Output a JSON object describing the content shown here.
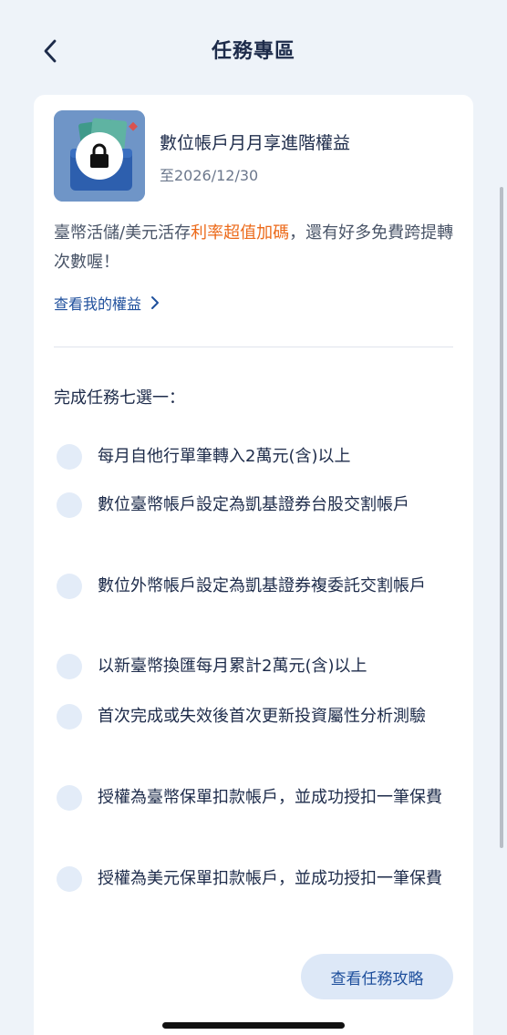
{
  "header": {
    "title": "任務專區",
    "back_icon": "chevron-left-icon"
  },
  "promo": {
    "image_icon": "lock-icon",
    "title": "數位帳戶月月享進階權益",
    "date": "至2026/12/30",
    "desc_before": "臺幣活儲/美元活存",
    "desc_highlight": "利率超值加碼",
    "desc_after": "，還有好多免費跨提轉次數喔！",
    "highlight_color": "#ec6a1a",
    "link_label": "查看我的權益",
    "link_icon": "chevron-right-icon"
  },
  "tasks": {
    "label": "完成任務七選一：",
    "items": [
      {
        "label": "每月自他行單筆轉入2萬元(含)以上"
      },
      {
        "label": "數位臺幣帳戶設定為凱基證券台股交割帳戶"
      },
      {
        "label": "數位外幣帳戶設定為凱基證券複委託交割帳戶"
      },
      {
        "label": "以新臺幣換匯每月累計2萬元(含)以上"
      },
      {
        "label": "首次完成或失效後首次更新投資屬性分析測驗"
      },
      {
        "label": "授權為臺幣保單扣款帳戶，並成功授扣一筆保費"
      },
      {
        "label": "授權為美元保單扣款帳戶，並成功授扣一筆保費"
      }
    ]
  },
  "footer": {
    "guide_button": "查看任務攻略"
  },
  "colors": {
    "accent": "#1e4f9c",
    "background": "#eef3f9",
    "radio": "#e3ecf8"
  }
}
